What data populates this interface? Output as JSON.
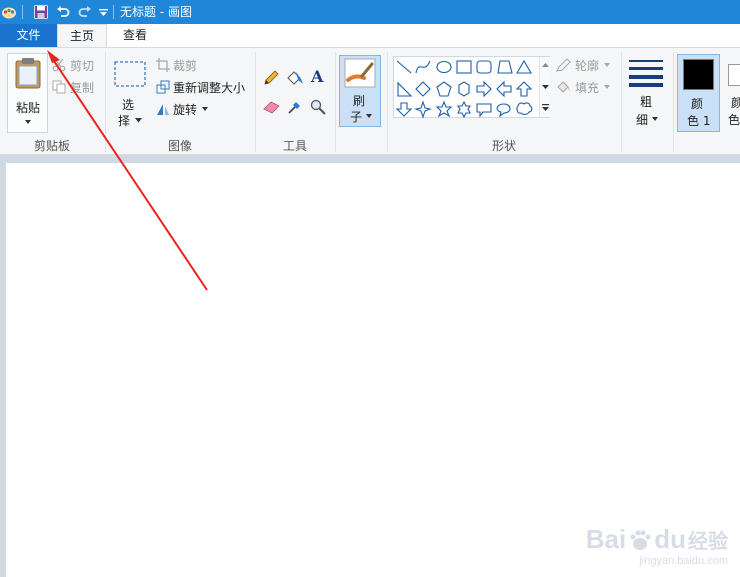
{
  "window": {
    "title": "无标题 - 画图"
  },
  "quick_access": {
    "app_icon": "paint-palette-icon",
    "save_icon": "save-icon",
    "undo_icon": "undo-icon",
    "redo_icon": "redo-icon",
    "customize_icon": "customize-qat-icon"
  },
  "tabs": [
    {
      "label": "文件"
    },
    {
      "label": "主页"
    },
    {
      "label": "查看"
    }
  ],
  "groups": {
    "clipboard": {
      "label": "剪贴板",
      "paste": {
        "line1": "粘贴"
      },
      "cut": "剪切",
      "copy": "复制"
    },
    "image": {
      "label": "图像",
      "select": {
        "line1": "选",
        "line2": "择"
      },
      "crop": "裁剪",
      "resize": "重新调整大小",
      "rotate": "旋转"
    },
    "tools": {
      "label": "工具"
    },
    "brushes": {
      "line1": "刷",
      "line2": "子"
    },
    "shapes": {
      "label": "形状",
      "outline": "轮廓",
      "fill": "填充"
    },
    "size": {
      "line1": "粗",
      "line2": "细"
    },
    "color1": {
      "line1": "颜",
      "line2": "色 1"
    },
    "color2": {
      "line1": "颜",
      "line2": "色"
    }
  },
  "colors": {
    "title_bar": "#1f86d8",
    "file_tab": "#1a74cf",
    "ribbon_bg": "#f5f6f7",
    "canvas_bg": "#cfd8e3",
    "color1": "#000000",
    "arrow": "#e8231f"
  },
  "watermark": {
    "brand": "Bai",
    "brand2": "du",
    "brand_cn": "经验",
    "url": "jingyan.baidu.com"
  }
}
